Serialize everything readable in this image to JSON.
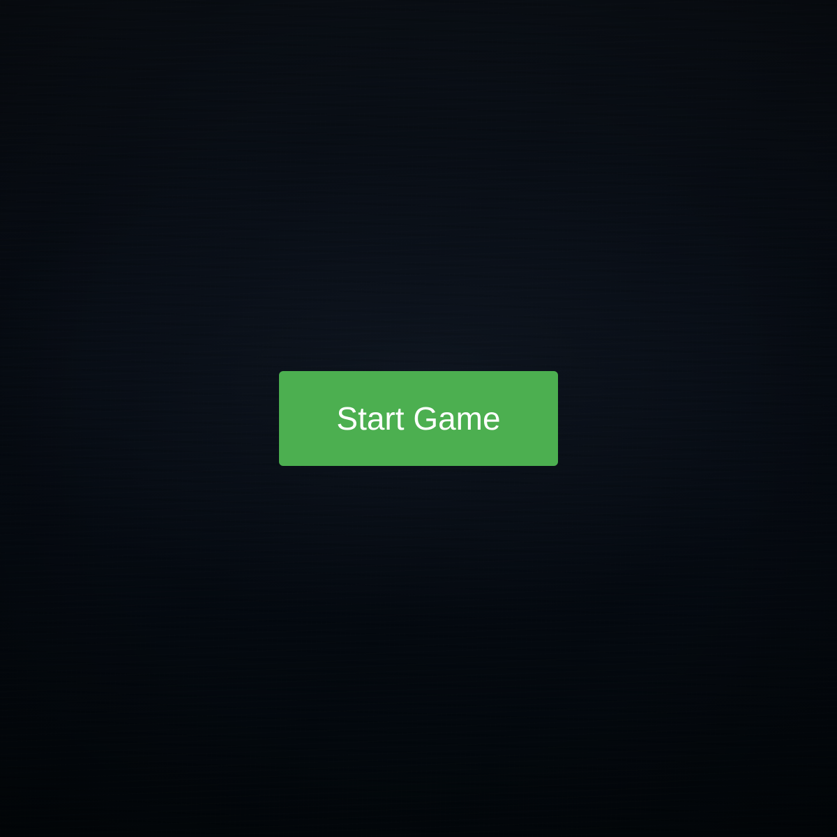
{
  "colors": {
    "background": "#060b12",
    "button_bg": "#4caf50",
    "button_text": "#ffffff"
  },
  "start_screen": {
    "start_label": "Start Game"
  }
}
